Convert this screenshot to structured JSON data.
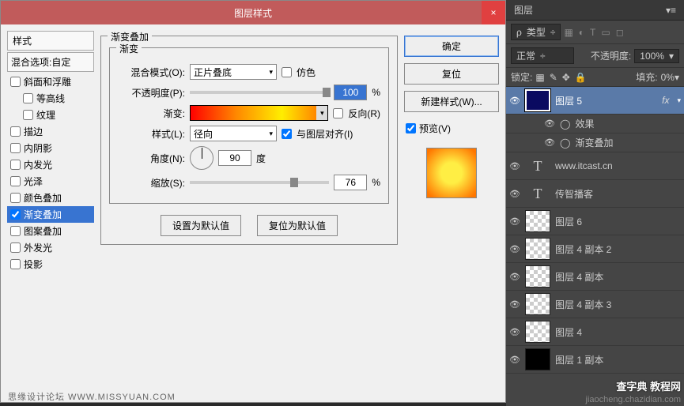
{
  "dialog": {
    "title": "图层样式",
    "styles_header": "样式",
    "blend_options": "混合选项:自定",
    "style_items": [
      {
        "label": "斜面和浮雕",
        "checked": false
      },
      {
        "label": "等高线",
        "checked": false,
        "indent": true
      },
      {
        "label": "纹理",
        "checked": false,
        "indent": true
      },
      {
        "label": "描边",
        "checked": false
      },
      {
        "label": "内阴影",
        "checked": false
      },
      {
        "label": "内发光",
        "checked": false
      },
      {
        "label": "光泽",
        "checked": false
      },
      {
        "label": "颜色叠加",
        "checked": false
      },
      {
        "label": "渐变叠加",
        "checked": true,
        "selected": true
      },
      {
        "label": "图案叠加",
        "checked": false
      },
      {
        "label": "外发光",
        "checked": false
      },
      {
        "label": "投影",
        "checked": false
      }
    ],
    "group_title": "渐变叠加",
    "subgroup_title": "渐变",
    "labels": {
      "blend_mode": "混合模式(O):",
      "opacity": "不透明度(P):",
      "gradient": "渐变:",
      "style": "样式(L):",
      "angle": "角度(N):",
      "scale": "缩放(S):",
      "dither": "仿色",
      "reverse": "反向(R)",
      "align": "与图层对齐(I)",
      "deg": "度",
      "pct": "%"
    },
    "values": {
      "blend_mode": "正片叠底",
      "opacity": "100",
      "style": "径向",
      "angle": "90",
      "scale": "76"
    },
    "buttons": {
      "set_default": "设置为默认值",
      "reset_default": "复位为默认值",
      "ok": "确定",
      "cancel": "复位",
      "new_style": "新建样式(W)...",
      "preview": "预览(V)"
    }
  },
  "layers_panel": {
    "tab": "图层",
    "kind": "类型",
    "blend": "正常",
    "opacity_label": "不透明度:",
    "opacity_val": "100%",
    "lock_label": "锁定:",
    "fill_label": "填充:",
    "fill_val": "0%",
    "layers": [
      {
        "name": "图层 5",
        "selected": true,
        "thumb": "navy",
        "fx": true
      },
      {
        "name": "效果",
        "sub": true,
        "eye": true
      },
      {
        "name": "渐变叠加",
        "sub": true,
        "eye": true
      },
      {
        "name": "www.itcast.cn",
        "type": "text"
      },
      {
        "name": "传智播客",
        "type": "text"
      },
      {
        "name": "图层 6",
        "thumb": "checker"
      },
      {
        "name": "图层 4 副本 2",
        "thumb": "checker"
      },
      {
        "name": "图层 4 副本",
        "thumb": "checker"
      },
      {
        "name": "图层 4 副本 3",
        "thumb": "checker"
      },
      {
        "name": "图层 4",
        "thumb": "checker"
      },
      {
        "name": "图层 1 副本",
        "thumb": "black"
      }
    ]
  },
  "watermarks": {
    "left": "思缘设计论坛  WWW.MISSYUAN.COM",
    "right_top": "查字典  教程网",
    "right_bottom": "jiaocheng.chazidian.com"
  }
}
